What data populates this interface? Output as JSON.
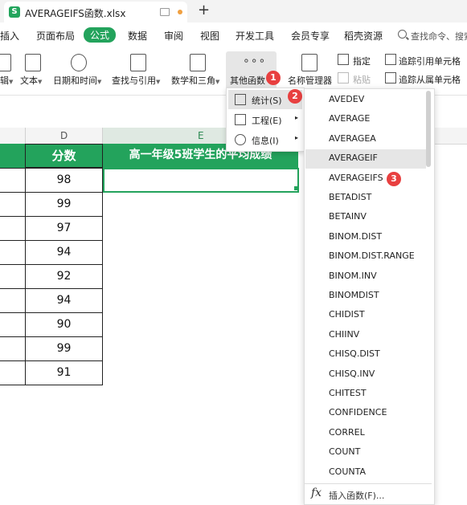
{
  "tab": {
    "icon": "S",
    "title": "AVERAGEIFS函数.xlsx",
    "new_tab": "+"
  },
  "menus": {
    "insert": "插入",
    "page_layout": "页面布局",
    "formulas": "公式",
    "data": "数据",
    "review": "审阅",
    "view": "视图",
    "developer": "开发工具",
    "member": "会员专享",
    "shell": "稻壳资源",
    "search": "查找命令、搜索"
  },
  "ribbon": {
    "logic_partial": "辑",
    "text": "文本",
    "datetime": "日期和时间",
    "lookup": "查找与引用",
    "math": "数学和三角",
    "more_functions": "其他函数",
    "name_manager": "名称管理器",
    "specify": "指定",
    "paste": "粘贴",
    "trace_precedents": "追踪引用单元格",
    "trace_dependents": "追踪从属单元格"
  },
  "badges": {
    "one": "1",
    "two": "2",
    "three": "3"
  },
  "sheet": {
    "col_d": "D",
    "col_e": "E",
    "header_d": "分数",
    "header_e": "高一年级5班学生的平均成绩",
    "scores": [
      "98",
      "99",
      "97",
      "94",
      "92",
      "94",
      "90",
      "99",
      "91"
    ]
  },
  "submenu": {
    "stats": "统计(S)",
    "engineering": "工程(E)",
    "info": "信息(I)"
  },
  "functions": [
    "AVEDEV",
    "AVERAGE",
    "AVERAGEA",
    "AVERAGEIF",
    "AVERAGEIFS",
    "BETADIST",
    "BETAINV",
    "BINOM.DIST",
    "BINOM.DIST.RANGE",
    "BINOM.INV",
    "BINOMDIST",
    "CHIDIST",
    "CHIINV",
    "CHISQ.DIST",
    "CHISQ.INV",
    "CHITEST",
    "CONFIDENCE",
    "CORREL",
    "COUNT",
    "COUNTA"
  ],
  "insert_function": {
    "icon": "fx",
    "label": "插入函数(F)..."
  },
  "colors": {
    "accent": "#23a35c",
    "badge": "#e84040"
  }
}
